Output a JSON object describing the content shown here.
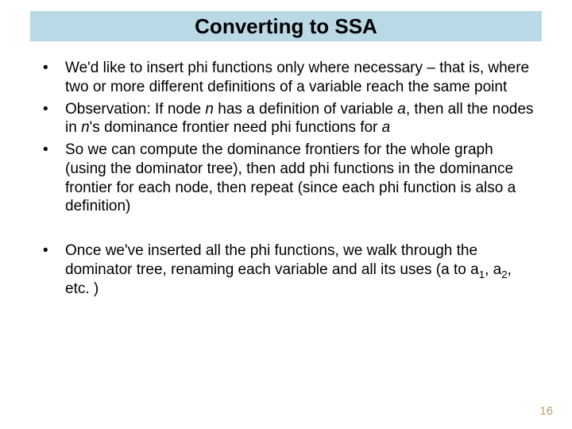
{
  "title": "Converting to SSA",
  "bullets_group1": {
    "b1": "We'd like to insert phi functions only where necessary – that is, where two or more different definitions of a variable reach the same point",
    "b2": {
      "t1": "Observation: If node ",
      "n1": "n",
      "t2": " has a definition of variable ",
      "a1": "a",
      "t3": ", then all the nodes in ",
      "n2": "n",
      "t4": "'s dominance frontier need phi functions for ",
      "a2": "a"
    },
    "b3": "So we can compute the dominance frontiers for the whole graph (using the dominator tree), then add phi functions in the dominance frontier for each node, then repeat (since each phi function is also a definition)"
  },
  "bullets_group2": {
    "b4": {
      "t1": "Once we've inserted all the phi functions, we walk through the dominator tree, renaming each variable and all its uses (a to a",
      "s1": "1",
      "t2": ", a",
      "s2": "2",
      "t3": ", etc. )"
    }
  },
  "page_number": "16"
}
